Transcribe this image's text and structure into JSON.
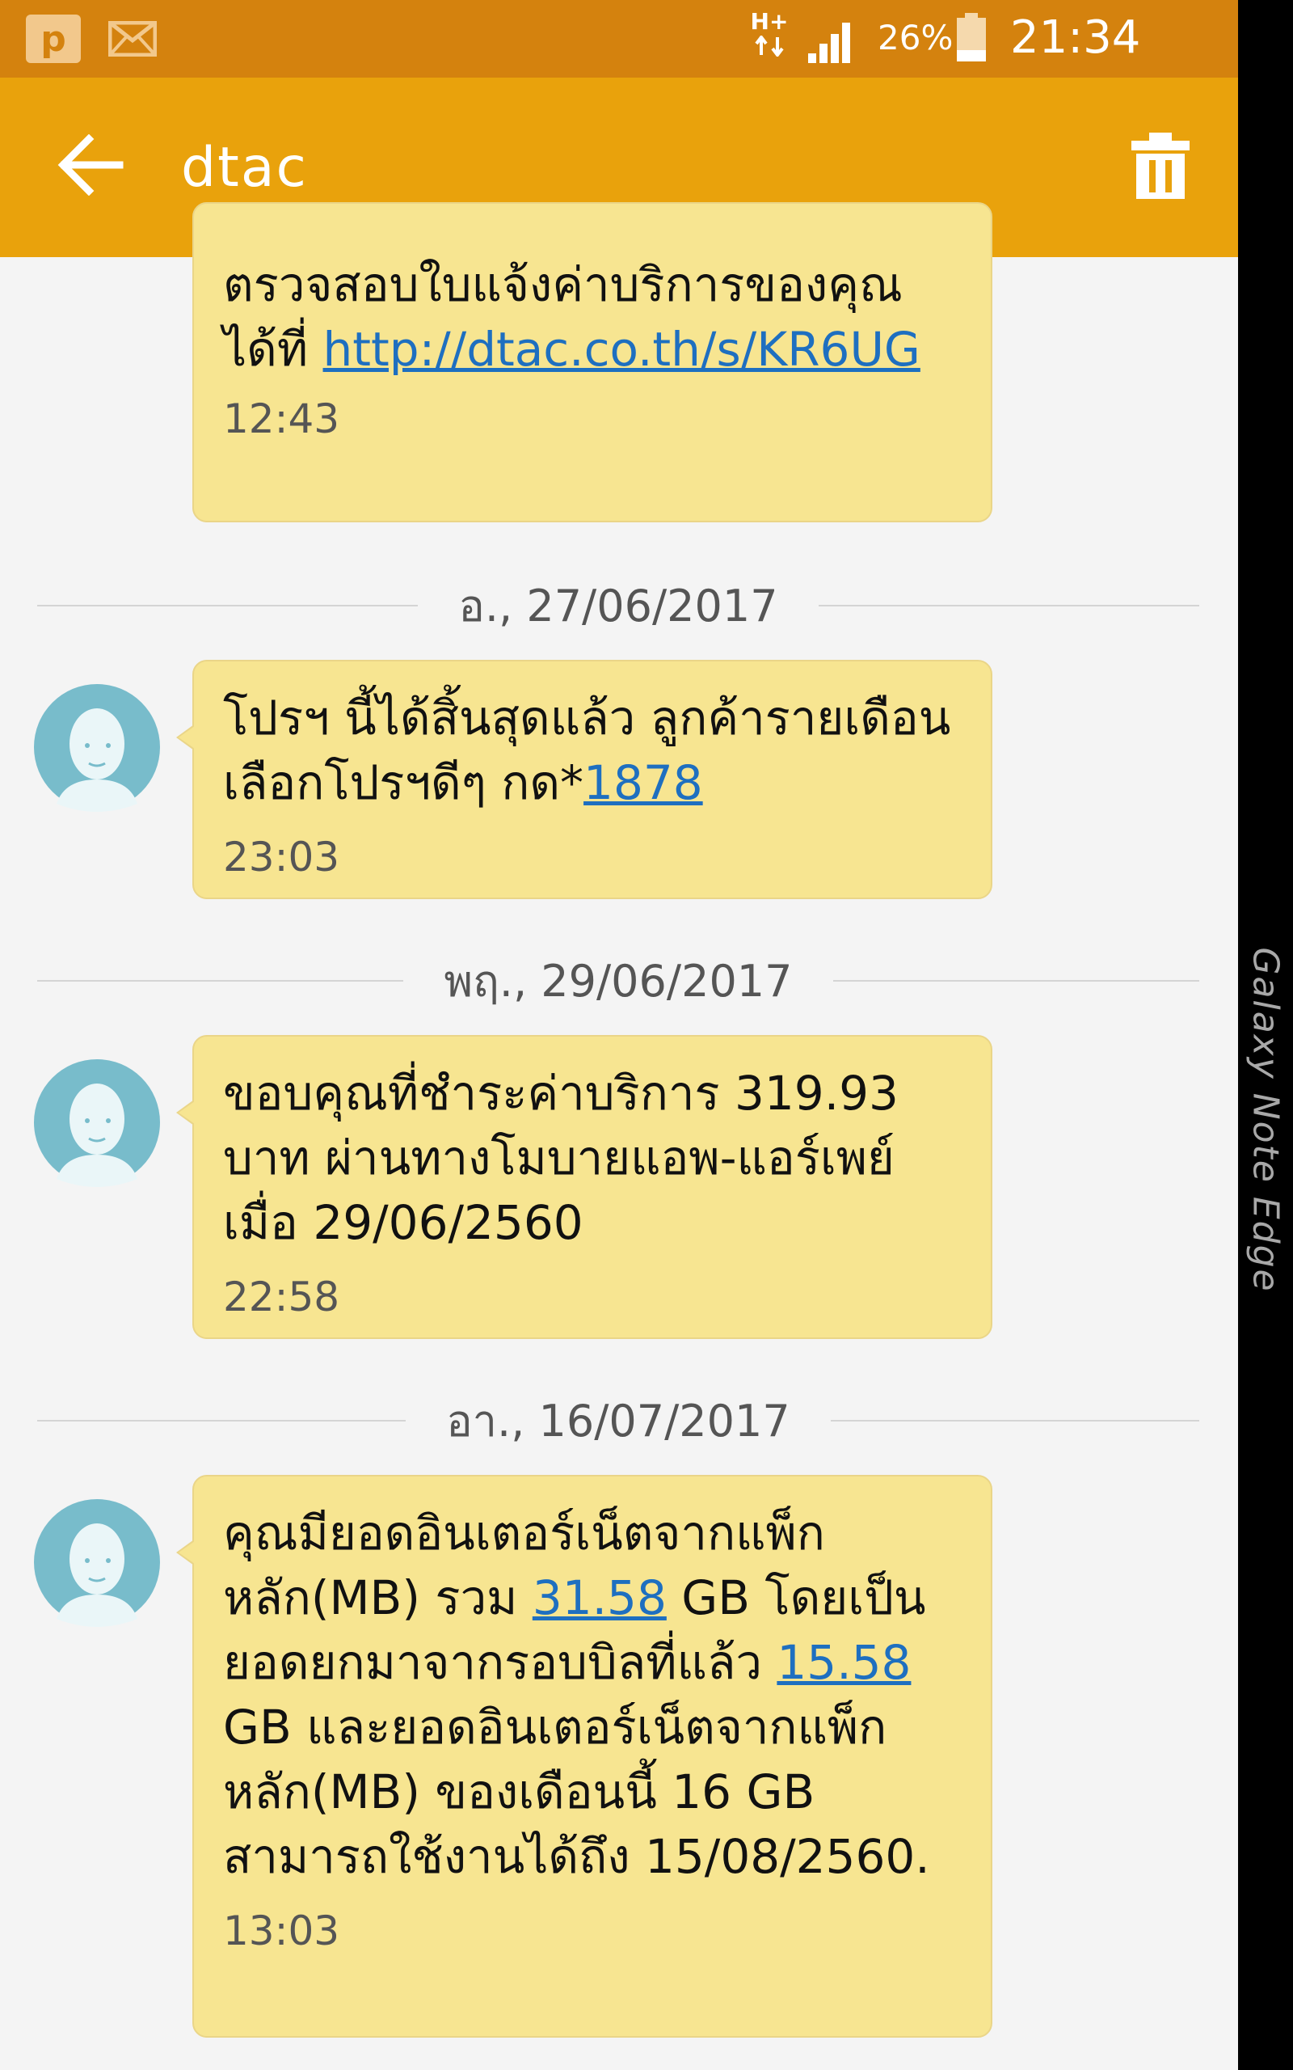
{
  "status_bar": {
    "network": "H+",
    "battery": "26%",
    "battery_level": 0.26,
    "time": "21:34",
    "notification_icons": [
      "p-app-icon",
      "mail-icon"
    ]
  },
  "app_bar": {
    "title": "dtac",
    "back_icon": "back-arrow-icon",
    "delete_icon": "trash-icon"
  },
  "conversation": [
    {
      "type": "message",
      "parts": [
        {
          "text": "ตรวจสอบใบแจ้งค่าบริการของคุณได้ที่ "
        },
        {
          "text": "http://dtac.co.th/s/KR6UG",
          "link": true
        }
      ],
      "time": "12:43"
    },
    {
      "type": "date",
      "label": "อ., 27/06/2017"
    },
    {
      "type": "message",
      "parts": [
        {
          "text": "โปรฯ นี้ได้สิ้นสุดแล้ว ลูกค้ารายเดือนเลือกโปรฯดีๆ กด*"
        },
        {
          "text": "1878",
          "link": true
        }
      ],
      "time": "23:03"
    },
    {
      "type": "date",
      "label": "พฤ., 29/06/2017"
    },
    {
      "type": "message",
      "parts": [
        {
          "text": "ขอบคุณที่ชำระค่าบริการ 319.93 บาท ผ่านทางโมบายแอพ-แอร์เพย์ เมื่อ 29/06/2560"
        }
      ],
      "time": "22:58"
    },
    {
      "type": "date",
      "label": "อา., 16/07/2017"
    },
    {
      "type": "message",
      "parts": [
        {
          "text": "คุณมียอดอินเตอร์เน็ตจากแพ็กหลัก(MB) รวม "
        },
        {
          "text": "31.58",
          "link": true
        },
        {
          "text": " GB โดยเป็นยอดยกมาจากรอบบิลที่แล้ว "
        },
        {
          "text": "15.58",
          "link": true
        },
        {
          "text": " GB และยอดอินเตอร์เน็ตจากแพ็กหลัก(MB) ของเดือนนี้ 16 GB สามารถใช้งานได้ถึง 15/08/2560."
        }
      ],
      "time": "13:03"
    }
  ],
  "device_edge_label": "Galaxy Note Edge",
  "colors": {
    "status_bar": "#d4820e",
    "app_bar": "#e9a20c",
    "bubble": "#f7e591",
    "link": "#1e6fc0",
    "background": "#f4f4f4",
    "avatar": "#78bccb"
  }
}
